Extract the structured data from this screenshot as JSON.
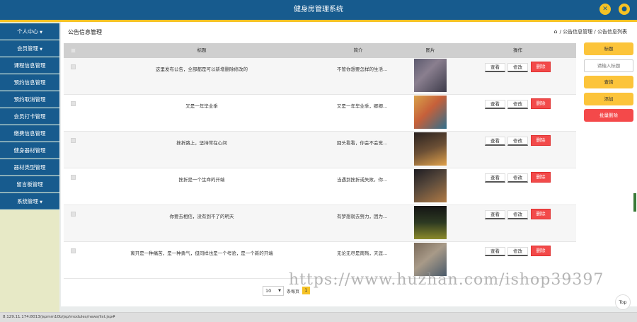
{
  "header": {
    "title": "健身房管理系统"
  },
  "sidebar": {
    "items": [
      {
        "label": "个人中心",
        "caret": "▼"
      },
      {
        "label": "会员管理",
        "caret": "▼"
      },
      {
        "label": "课程信息管理",
        "caret": ""
      },
      {
        "label": "预约信息管理",
        "caret": ""
      },
      {
        "label": "预约取消管理",
        "caret": ""
      },
      {
        "label": "会员打卡管理",
        "caret": ""
      },
      {
        "label": "缴费信息管理",
        "caret": ""
      },
      {
        "label": "健身器材管理",
        "caret": ""
      },
      {
        "label": "器材类型管理",
        "caret": ""
      },
      {
        "label": "留言板管理",
        "caret": ""
      },
      {
        "label": "系统管理",
        "caret": "▼"
      }
    ]
  },
  "page": {
    "title": "公告信息管理"
  },
  "breadcrumb": {
    "items": [
      "公告信息管理",
      "公告信息列表"
    ],
    "sep": "/"
  },
  "table": {
    "columns": [
      "标题",
      "简介",
      "图片",
      "操作"
    ],
    "rows": [
      {
        "title": "这里发布公告，全部都是可以新增删除修改的",
        "intro": "不管你想要怎样的生活..."
      },
      {
        "title": "又是一年毕业季",
        "intro": "又是一年毕业季，卿卿..."
      },
      {
        "title": "挫折路上，坚持常在心间",
        "intro": "回头看看，你会不会觉..."
      },
      {
        "title": "挫折是一个生命的开端",
        "intro": "当遇到挫折或失败，你..."
      },
      {
        "title": "你要去相信，没有到不了的明天",
        "intro": "有梦想就去努力，因为..."
      },
      {
        "title": "离开是一种痛苦，是一种勇气，但同样也是一个考验，是一个新的开端",
        "intro": "无论无尽是南殇，天涯..."
      }
    ],
    "actions": {
      "view": "查看",
      "edit": "修改",
      "delete": "删除"
    }
  },
  "pagination": {
    "page_size": "10",
    "per_page_label": "条每页",
    "current_page": "1"
  },
  "right_panel": {
    "title_label": "标题",
    "search_placeholder": "请输入标题",
    "query_button": "查询",
    "add_button": "添加",
    "batch_delete_button": "批量删除"
  },
  "top_button": "Top",
  "watermark": "https://www.huzhan.com/ishop39397",
  "status": {
    "url": "8.129.11.174:8013/jspmm10b/jsp/modules/news/list.jsp#"
  },
  "colors": {
    "primary": "#175b8e",
    "accent": "#f5c225",
    "danger": "#f24a4a"
  },
  "icons": {
    "fullscreen": "expand-icon",
    "user": "user-icon",
    "home": "home-icon"
  }
}
